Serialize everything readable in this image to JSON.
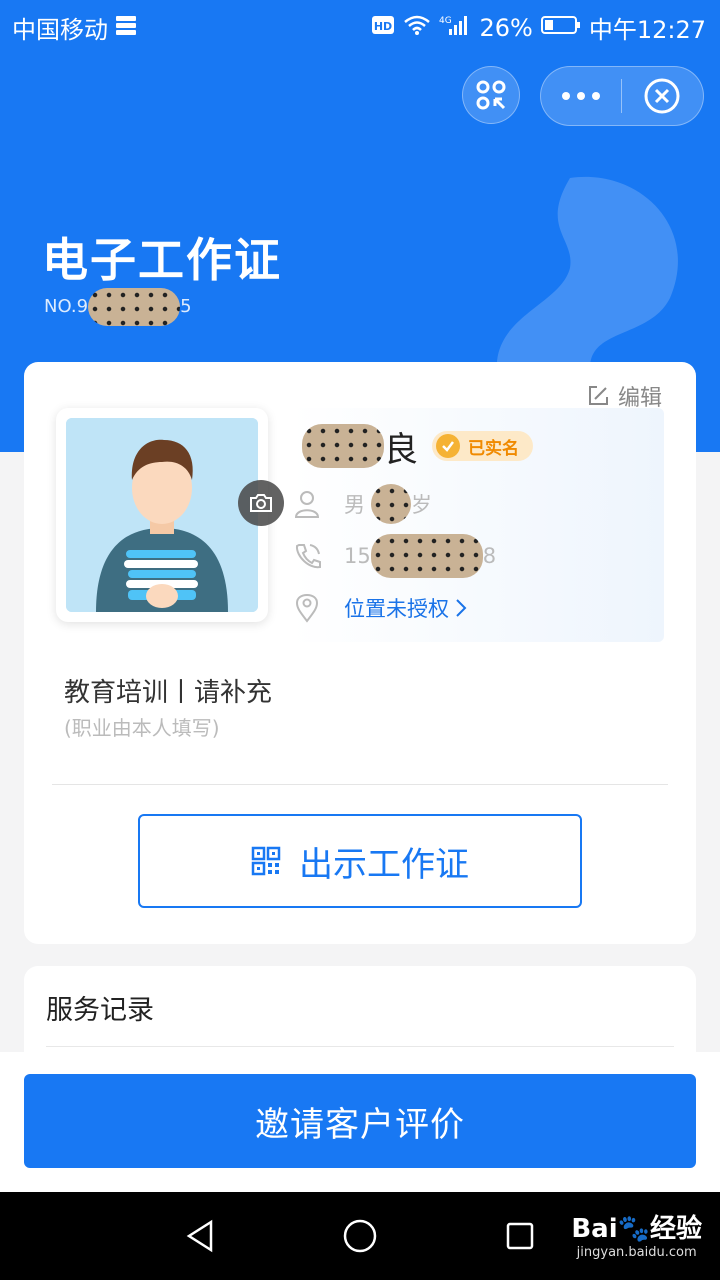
{
  "status_bar": {
    "carrier": "中国移动",
    "network": "4G",
    "battery": "26%",
    "time": "中午12:27"
  },
  "header": {
    "title": "电子工作证",
    "no_prefix": "NO.9",
    "no_suffix": "5"
  },
  "profile": {
    "edit_label": "编辑",
    "name_suffix": "良",
    "verified_label": "已实名",
    "gender": "男",
    "age_unit": "岁",
    "phone_prefix": "15",
    "phone_suffix": "8",
    "location_label": "位置未授权",
    "job": "教育培训丨请补充",
    "job_hint": "(职业由本人填写)",
    "show_card_label": "出示工作证"
  },
  "records": {
    "title": "服务记录"
  },
  "actions": {
    "invite_label": "邀请客户评价"
  },
  "watermark": {
    "brand": "Bai",
    "brand_cn": "经验",
    "url": "jingyan.baidu.com"
  },
  "colors": {
    "primary": "#1878f3",
    "verified": "#f5b234",
    "background": "#f4f4f5"
  }
}
